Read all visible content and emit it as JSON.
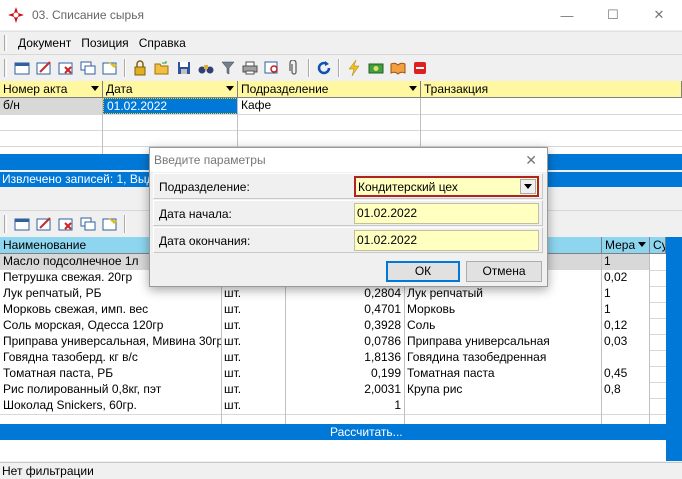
{
  "window": {
    "title": "03. Списание сырья",
    "controls": [
      "—",
      "☐",
      "✕"
    ]
  },
  "menu": [
    "Документ",
    "Позиция",
    "Справка"
  ],
  "top_grid": {
    "columns": [
      "Номер акта",
      "Дата",
      "Подразделение",
      "Транзакция"
    ],
    "rows": [
      {
        "number": "б/н",
        "date": "01.02.2022",
        "department": "Кафе",
        "transaction": ""
      }
    ],
    "status": "Извлечено записей: 1, Выде"
  },
  "bottom_grid": {
    "columns": {
      "name": "Наименование",
      "measure": "Мера",
      "su": "Су"
    },
    "rows": [
      {
        "name": "Масло подсолнечное 1л",
        "unit": "",
        "qty": "",
        "product": "",
        "measure": "1"
      },
      {
        "name": "Петрушка свежая. 20гр",
        "unit": "",
        "qty": "",
        "product": "",
        "measure": "0,02"
      },
      {
        "name": "Лук репчатый, РБ",
        "unit": "шт.",
        "qty": "0,2804",
        "product": "Лук репчатый",
        "measure": "1"
      },
      {
        "name": "Морковь свежая, имп. вес",
        "unit": "шт.",
        "qty": "0,4701",
        "product": "Морковь",
        "measure": "1"
      },
      {
        "name": "Соль морская, Одесса 120гр",
        "unit": "шт.",
        "qty": "0,3928",
        "product": "Соль",
        "measure": "0,12"
      },
      {
        "name": "Приправа универсальная, Мивина 30гр",
        "unit": "шт.",
        "qty": "0,0786",
        "product": "Приправа универсальная",
        "measure": "0,03"
      },
      {
        "name": "Говядна тазоберд. кг в/с",
        "unit": "шт.",
        "qty": "1,8136",
        "product": "Говядина тазобедренная",
        "measure": ""
      },
      {
        "name": "Томатная паста, РБ",
        "unit": "шт.",
        "qty": "0,199",
        "product": "Томатная паста",
        "measure": "0,45"
      },
      {
        "name": "Рис полированный 0,8кг, пэт",
        "unit": "шт.",
        "qty": "2,0031",
        "product": "Крупа рис",
        "measure": "0,8"
      },
      {
        "name": "Шоколад Snickers, 60гр.",
        "unit": "шт.",
        "qty": "1",
        "product": "",
        "measure": ""
      }
    ],
    "calc_label": "Рассчитать..."
  },
  "status_bar": "Нет фильтрации",
  "dialog": {
    "title": "Введите параметры",
    "fields": [
      {
        "label": "Подразделение:",
        "value": "Кондитерский цех"
      },
      {
        "label": "Дата начала:",
        "value": "01.02.2022"
      },
      {
        "label": "Дата окончания:",
        "value": "01.02.2022"
      }
    ],
    "ok_label": "ОК",
    "cancel_label": "Отмена"
  },
  "colors": {
    "header_yellow": "#fff8a0",
    "selection_blue": "#0078d7",
    "field_yellow": "#ffffc0",
    "header_cyan": "#8ed6f0"
  }
}
